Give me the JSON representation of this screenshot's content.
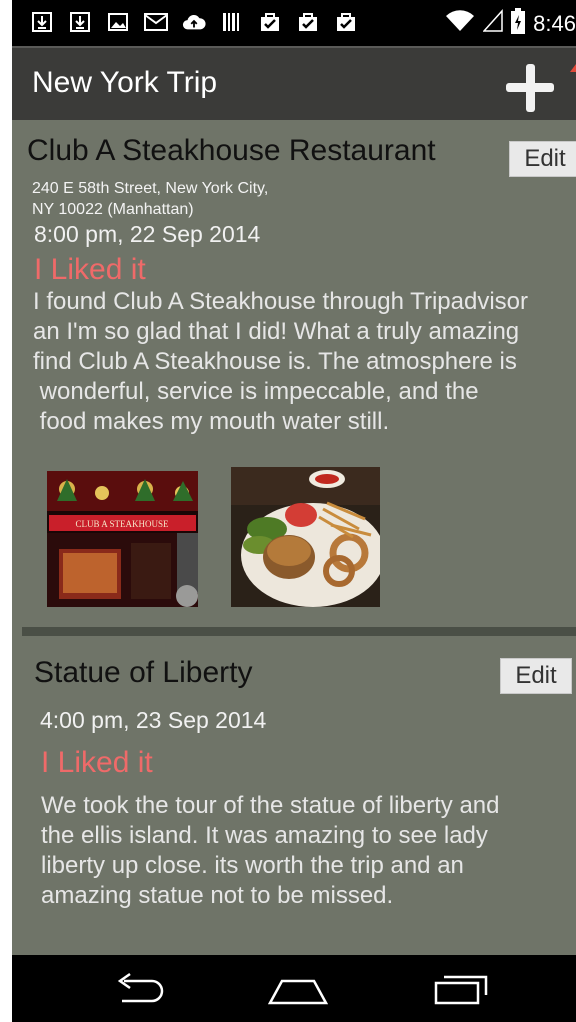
{
  "app": {
    "title": "New York Trip"
  },
  "status_bar": {
    "time": "8:46"
  },
  "entries": [
    {
      "title": "Club A Steakhouse Restaurant",
      "edit_label": "Edit",
      "address_line1": "240 E 58th Street, New York City,",
      "address_line2": "NY 10022 (Manhattan)",
      "datetime": "8:00 pm, 22 Sep 2014",
      "rating": "I Liked it",
      "description_lines": [
        "I found Club A Steakhouse through Tripadvisor",
        "an I'm so glad that I did! What a truly amazing",
        "find Club A Steakhouse is. The atmosphere is",
        " wonderful, service is impeccable, and the",
        " food makes my mouth water still."
      ],
      "photo1_sign": "CLUB A STEAKHOUSE"
    },
    {
      "title": "Statue of Liberty",
      "edit_label": "Edit",
      "datetime": "4:00 pm, 23 Sep 2014",
      "rating": "I Liked it",
      "description_lines": [
        "We took the tour of the statue of liberty and",
        "the ellis island. It was amazing to see lady",
        "liberty up close. its worth the trip and an",
        "amazing statue not to be missed."
      ]
    }
  ],
  "colors": {
    "background": "#6f7468",
    "app_bar": "#3b3b39",
    "rating": "#ef6a69"
  },
  "icons": {
    "status": [
      "download-icon",
      "download-icon",
      "image-icon",
      "gmail-icon",
      "cloud-upload-icon",
      "barcode-icon",
      "shopping-bag-icon",
      "shopping-bag-icon",
      "shopping-bag-icon",
      "wifi-icon",
      "signal-icon",
      "battery-icon"
    ],
    "nav": [
      "back-icon",
      "home-icon",
      "recents-icon"
    ]
  }
}
